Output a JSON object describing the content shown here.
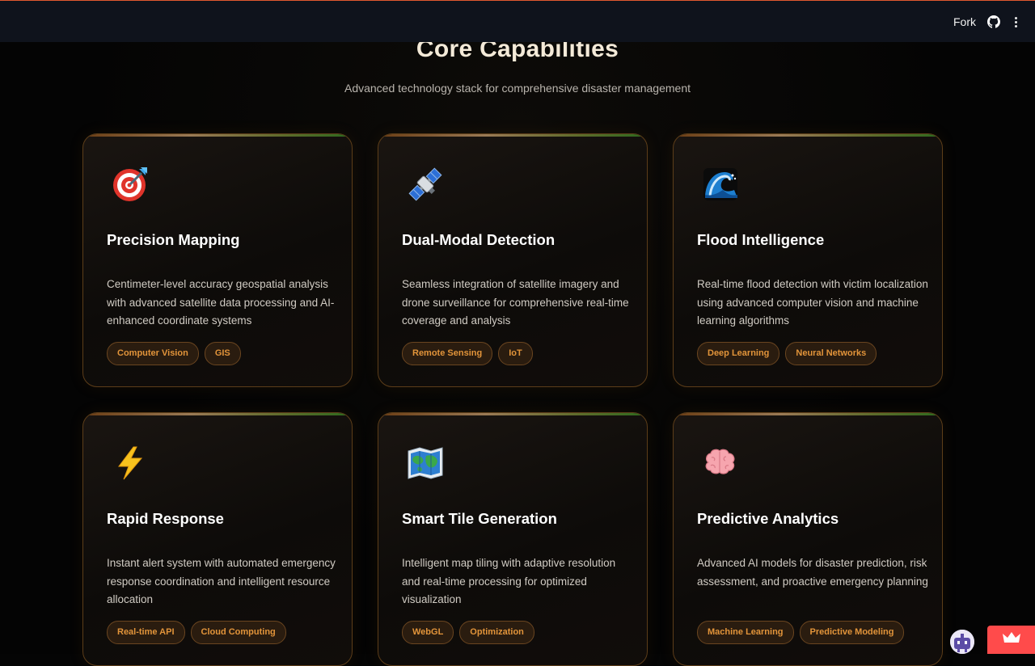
{
  "topbar": {
    "fork_label": "Fork",
    "github_icon": "github-icon",
    "menu_icon": "vertical-ellipsis-icon"
  },
  "section": {
    "title": "Core Capabilities",
    "subtitle": "Advanced technology stack for comprehensive disaster management"
  },
  "cards": [
    {
      "icon": "target-icon",
      "title": "Precision Mapping",
      "description": "Centimeter-level accuracy geospatial analysis with advanced satellite data processing and AI-enhanced coordinate systems",
      "tags": [
        "Computer Vision",
        "GIS"
      ]
    },
    {
      "icon": "satellite-icon",
      "title": "Dual-Modal Detection",
      "description": "Seamless integration of satellite imagery and drone surveillance for comprehensive real-time coverage and analysis",
      "tags": [
        "Remote Sensing",
        "IoT"
      ]
    },
    {
      "icon": "wave-icon",
      "title": "Flood Intelligence",
      "description": "Real-time flood detection with victim localization using advanced computer vision and machine learning algorithms",
      "tags": [
        "Deep Learning",
        "Neural Networks"
      ]
    },
    {
      "icon": "lightning-icon",
      "title": "Rapid Response",
      "description": "Instant alert system with automated emergency response coordination and intelligent resource allocation",
      "tags": [
        "Real-time API",
        "Cloud Computing"
      ]
    },
    {
      "icon": "map-icon",
      "title": "Smart Tile Generation",
      "description": "Intelligent map tiling with adaptive resolution and real-time processing for optimized visualization",
      "tags": [
        "WebGL",
        "Optimization"
      ]
    },
    {
      "icon": "brain-icon",
      "title": "Predictive Analytics",
      "description": "Advanced AI models for disaster prediction, risk assessment, and proactive emergency planning",
      "tags": [
        "Machine Learning",
        "Predictive Modeling"
      ]
    }
  ],
  "floating": {
    "bot_icon": "bot-avatar-icon",
    "crown_icon": "crown-icon"
  },
  "colors": {
    "accent_orange": "#e2943a",
    "card_border": "#5c3d19",
    "background": "#050505",
    "topbar": "#0f131c",
    "crown_button": "#ff4b4b"
  }
}
